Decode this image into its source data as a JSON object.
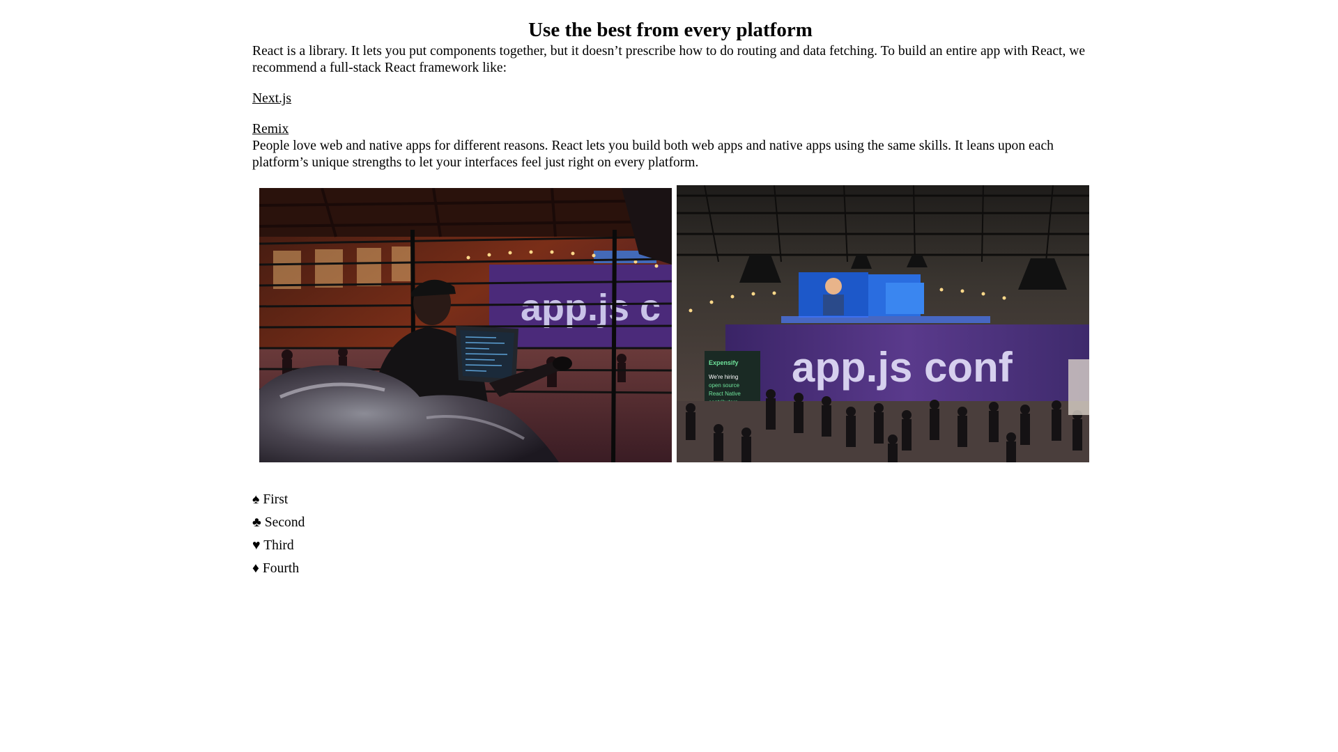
{
  "section": {
    "title": "Use the best from every platform",
    "intro": "React is a library. It lets you put components together, but it doesn’t prescribe how to do routing and data fetching. To build an entire app with React, we recommend a full-stack React framework like:",
    "frameworks": [
      "Next.js",
      "Remix"
    ],
    "description": "People love web and native apps for different reasons. React lets you build both web apps and native apps using the same skills. It leans upon each platform’s unique strengths to let your interfaces feel just right on every platform."
  },
  "gallery": {
    "photo1": {
      "banner_text": "app.js c"
    },
    "photo2": {
      "banner_text": "app.js conf",
      "sign_brand": "Expensify",
      "sign_lines": [
        "We're hiring",
        "open source",
        "React Native",
        "contributors"
      ]
    }
  },
  "suits": [
    {
      "symbol": "♠",
      "label": "First"
    },
    {
      "symbol": "♣",
      "label": "Second"
    },
    {
      "symbol": "♥",
      "label": "Third"
    },
    {
      "symbol": "♦",
      "label": "Fourth"
    }
  ]
}
